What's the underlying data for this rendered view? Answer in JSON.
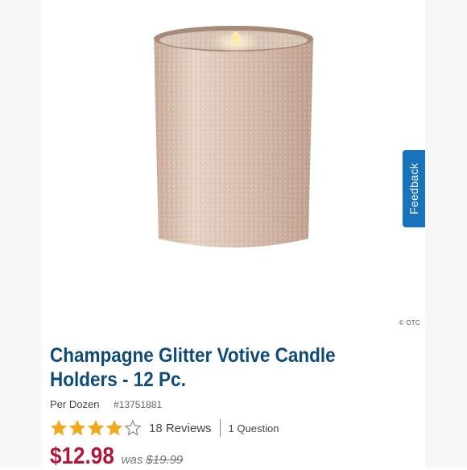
{
  "feedback": {
    "label": "Feedback"
  },
  "image": {
    "copyright": "© OTC"
  },
  "product": {
    "title": "Champagne Glitter Votive Candle Holders - 12 Pc.",
    "unit": "Per Dozen",
    "sku": "#13751881",
    "rating": 4,
    "rating_max": 5,
    "reviews": "18 Reviews",
    "questions": "1 Question",
    "price": "$12.98",
    "was_label": "was",
    "was_price": "$19.99"
  },
  "colors": {
    "title": "#0e4b76",
    "price": "#b0173b",
    "star": "#f0a91c",
    "feedback": "#1a73b8"
  }
}
